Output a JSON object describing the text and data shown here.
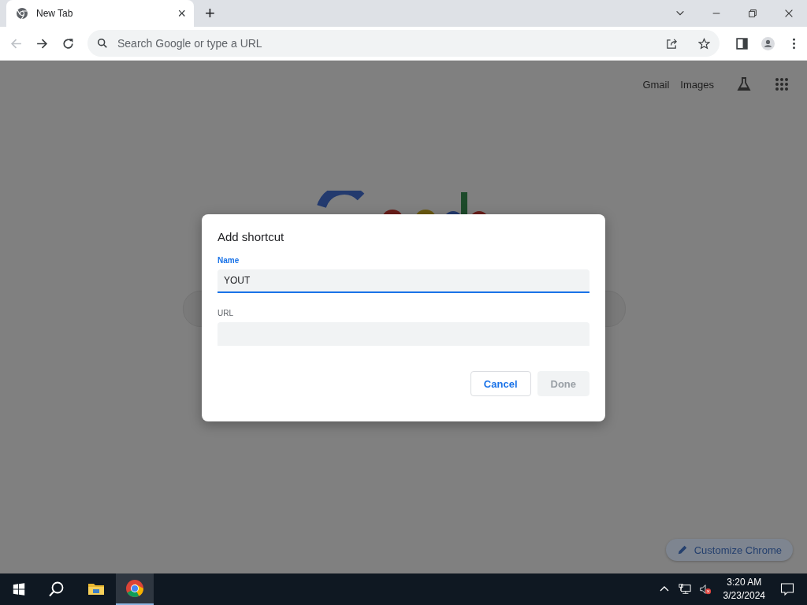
{
  "browser": {
    "tabs": [
      {
        "title": "New Tab",
        "close": "×",
        "selected": true
      }
    ],
    "new_tab": "+",
    "address_bar": {
      "placeholder": "Search Google or type a URL"
    }
  },
  "page": {
    "links": [
      "Gmail",
      "Images"
    ],
    "customize_button": "Customize Chrome"
  },
  "dialog": {
    "title": "Add shortcut",
    "fields": [
      {
        "label": "Name",
        "value": "YOUT",
        "focused": true
      },
      {
        "label": "URL",
        "focused": false
      }
    ],
    "buttons": [
      {
        "label": "Cancel",
        "disabled": false
      },
      {
        "label": "Done",
        "disabled": true
      }
    ]
  },
  "taskbar": {
    "chrome_active": true,
    "clock": {
      "time": "3:20 AM",
      "date": "3/23/2024"
    }
  }
}
